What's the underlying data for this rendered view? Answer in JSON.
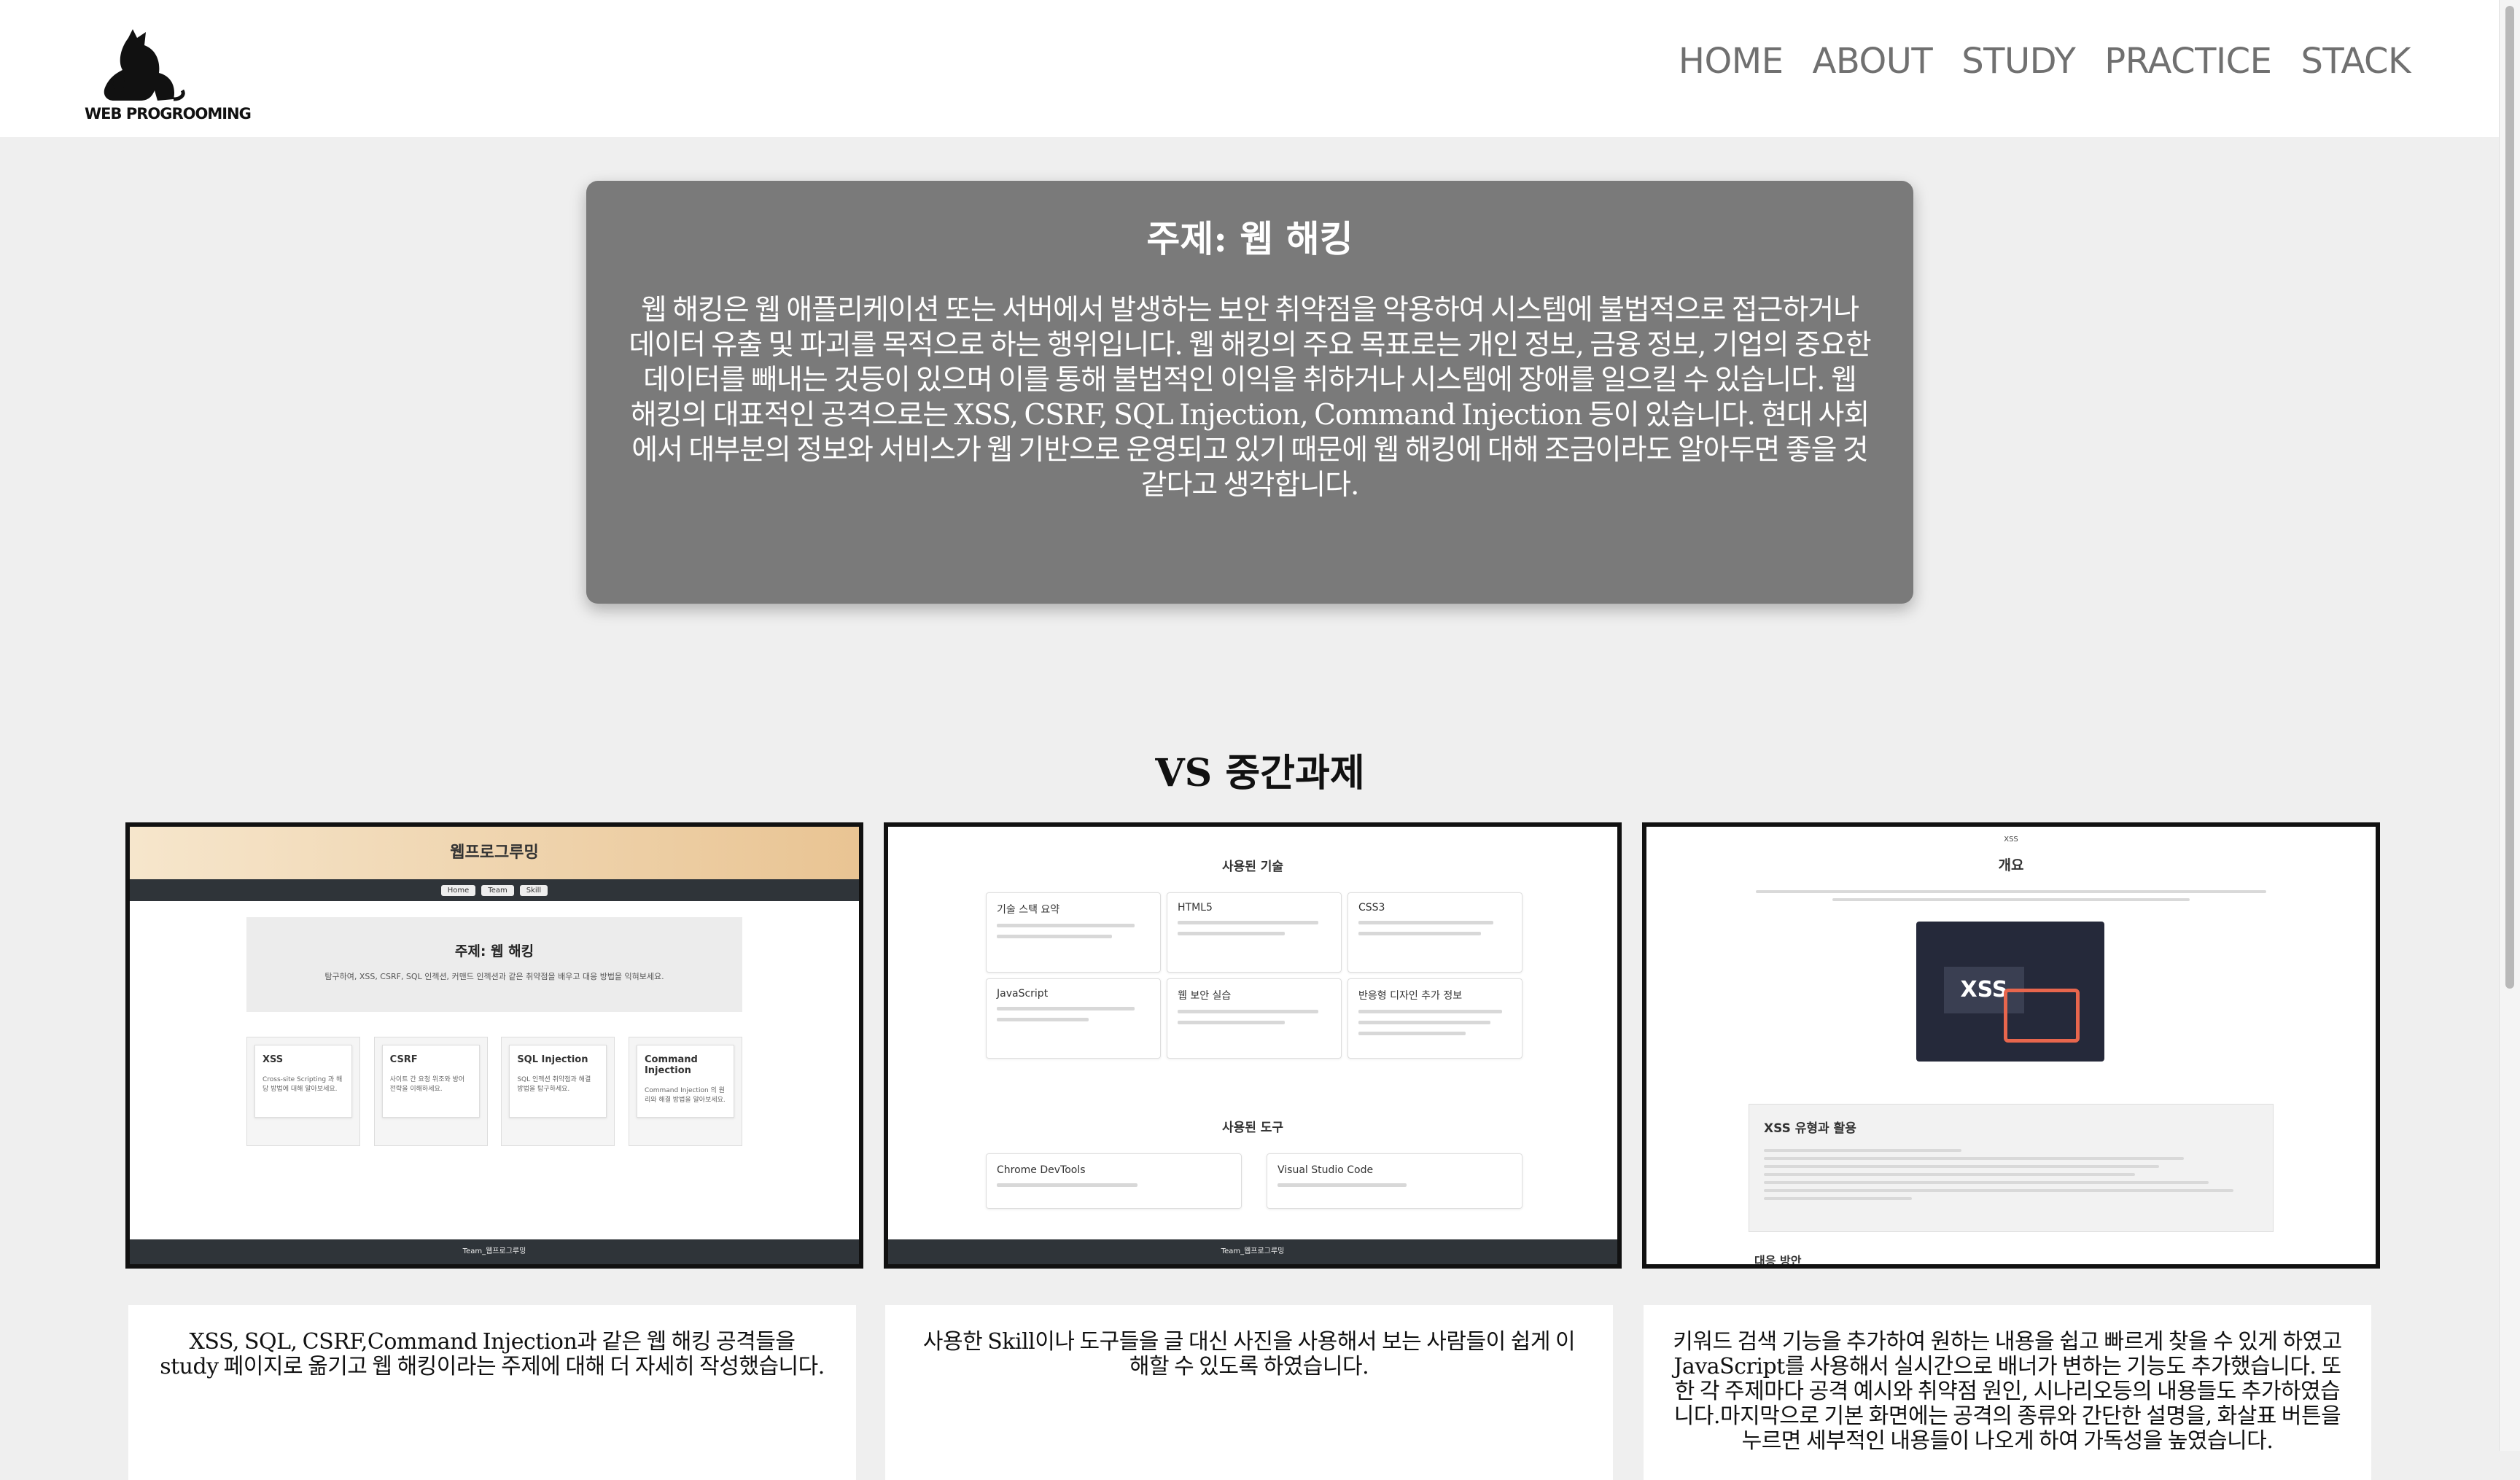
{
  "header": {
    "logo_text": "WEB PROGROOMING",
    "nav": [
      "HOME",
      "ABOUT",
      "STUDY",
      "PRACTICE",
      "STACK"
    ]
  },
  "intro": {
    "title": "주제: 웹 해킹",
    "body": "웹 해킹은 웹 애플리케이션 또는 서버에서 발생하는 보안 취약점을 악용하여 시스템에 불법적으로 접근하거나 데이터 유출 및 파괴를 목적으로 하는 행위입니다. 웹 해킹의 주요 목표로는 개인 정보, 금융 정보, 기업의 중요한 데이터를 빼내는 것등이 있으며 이를 통해 불법적인 이익을 취하거나 시스템에 장애를 일으킬 수 있습니다. 웹 해킹의 대표적인 공격으로는 XSS, CSRF, SQL Injection, Command Injection 등이 있습니다. 현대 사회에서 대부분의 정보와 서비스가 웹 기반으로 운영되고 있기 때문에 웹 해킹에 대해 조금이라도 알아두면 좋을 것 같다고 생각합니다."
  },
  "section_title": "VS 중간과제",
  "screenshots": {
    "shot1": {
      "header_title": "웹프로그루밍",
      "nav": [
        "Home",
        "Team",
        "Skill"
      ],
      "topic_title": "주제: 웹 해킹",
      "topic_sub": "탐구하여, XSS, CSRF, SQL 인젝션, 커맨드 인젝션과 같은 취약점을 배우고 대응 방법을 익혀보세요.",
      "cards": [
        {
          "title": "XSS",
          "text": "Cross-site Scripting 과 해당 방법에 대해 알아보세요."
        },
        {
          "title": "CSRF",
          "text": "사이트 간 요청 위조와 방어 전략을 이해하세요."
        },
        {
          "title": "SQL Injection",
          "text": "SQL 인젝션 취약점과 해결 방법을 탐구하세요."
        },
        {
          "title": "Command Injection",
          "text": "Command Injection 의 원리와 해결 방법을 알아보세요."
        }
      ],
      "footer": "Team_웹프로그루밍"
    },
    "shot2": {
      "tech_title": "사용된 기술",
      "tech": [
        "기술 스택 요약",
        "HTML5",
        "CSS3",
        "JavaScript",
        "웹 보안 실습",
        "반응형 디자인 추가 정보"
      ],
      "tools_title": "사용된 도구",
      "tools": [
        "Chrome DevTools",
        "Visual Studio Code"
      ],
      "footer": "Team_웹프로그루밍"
    },
    "shot3": {
      "small_title": "XSS",
      "title": "개요",
      "image_label": "XSS",
      "panel_title": "XSS 유형과 활용",
      "bottom_hint": "대응 방안"
    }
  },
  "descriptions": [
    "XSS, SQL, CSRF,Command Injection과 같은 웹 해킹 공격들을 study 페이지로 옮기고 웹 해킹이라는 주제에 대해 더 자세히 작성했습니다.",
    "사용한 Skill이나 도구들을 글 대신 사진을 사용해서 보는 사람들이 쉽게 이해할 수 있도록 하였습니다.",
    "키워드 검색 기능을 추가하여 원하는 내용을 쉽고 빠르게 찾을 수 있게 하였고 JavaScript를 사용해서 실시간으로 배너가 변하는 기능도 추가했습니다. 또한 각 주제마다 공격 예시와 취약점 원인, 시나리오등의 내용들도 추가하였습니다.마지막으로 기본 화면에는 공격의 종류와 간단한 설명을, 화살표 버튼을 누르면 세부적인 내용들이 나오게 하여 가독성을 높였습니다."
  ]
}
